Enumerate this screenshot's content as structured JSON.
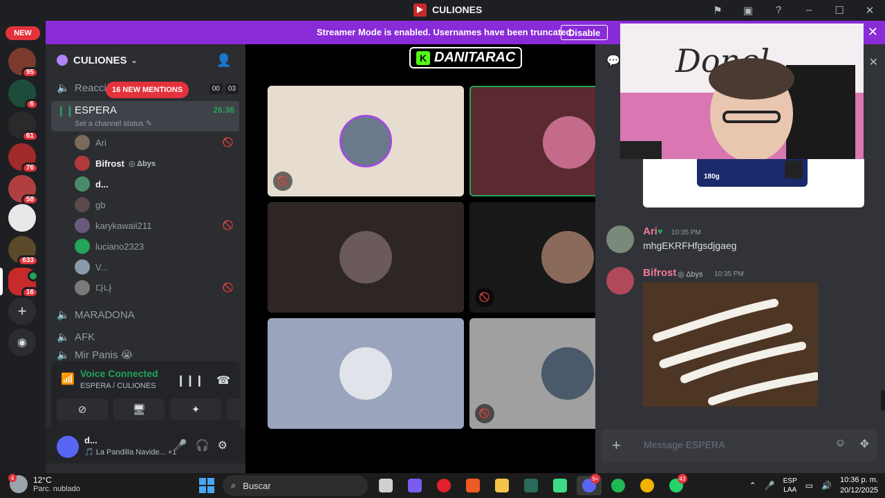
{
  "window": {
    "title": "CULIONES"
  },
  "rail": {
    "new_label": "NEW",
    "servers": [
      {
        "name": "server-1",
        "badge": "95",
        "color": "#7a3b2e"
      },
      {
        "name": "server-2",
        "badge": "6",
        "color": "#1d4d3a"
      },
      {
        "name": "server-3",
        "badge": "61",
        "color": "#2a2a2a"
      },
      {
        "name": "server-4",
        "badge": "76",
        "color": "#a12a2a"
      },
      {
        "name": "server-5",
        "badge": "58",
        "color": "#b04040"
      },
      {
        "name": "server-6",
        "badge": "",
        "color": "#e8e8e8"
      },
      {
        "name": "server-7",
        "badge": "633",
        "color": "#5a4a2a"
      },
      {
        "name": "server-8",
        "badge": "16",
        "color": "#c62a2a"
      }
    ]
  },
  "banner": {
    "text": "Streamer Mode is enabled. Usernames have been truncated.",
    "button": "Disable"
  },
  "sidebar": {
    "guild_name": "CULIONES",
    "channels_top": {
      "name": "Reacciones",
      "mentions": "16 NEW MENTIONS",
      "count_a": "00",
      "count_b": "03"
    },
    "active_channel": {
      "name": "ESPERA",
      "status": "Set a channel status",
      "timer": "26:36"
    },
    "users": [
      {
        "name": "Ari",
        "muted": true,
        "color": "#7a6a5a"
      },
      {
        "name": "Bifrost",
        "tag": "Δbys",
        "muted": false,
        "color": "#b03a3a",
        "bright": true
      },
      {
        "name": "d...",
        "muted": false,
        "color": "#4a8a6a",
        "bright": true
      },
      {
        "name": "gb",
        "muted": false,
        "color": "#5a4a4a"
      },
      {
        "name": "karykawaii211",
        "muted": true,
        "color": "#6a5a7a"
      },
      {
        "name": "luciano2323",
        "muted": false,
        "color": "#23a55a"
      },
      {
        "name": "V...",
        "muted": false,
        "color": "#8a9aaa"
      },
      {
        "name": "다나",
        "muted": true,
        "color": "#7a7a7a"
      }
    ],
    "other_channels": [
      "MARADONA",
      "AFK",
      "Mir Panis 😭"
    ]
  },
  "voice": {
    "title": "Voice Connected",
    "subtitle": "ESPERA / CULIONES"
  },
  "userbar": {
    "name": "d...",
    "status": "🎵 La Pandilla Navide...",
    "extra": "+1"
  },
  "stage": {
    "streamer_label": "DANITARAC",
    "kick_letter": "K"
  },
  "chat": {
    "messages": [
      {
        "author": "Ari",
        "time": "10:35 PM",
        "text": "mhgEKRFHfgsdjgaeg"
      },
      {
        "author": "Bifrost",
        "tag": "Δbys",
        "time": "10:35 PM",
        "text": ""
      }
    ],
    "placeholder": "Message ESPERA",
    "product_text": "180g"
  },
  "taskbar": {
    "temp": "12°C",
    "condition": "Parc. nublado",
    "weather_badge": "4",
    "search": "Buscar",
    "lang_a": "ESP",
    "lang_b": "LAA",
    "time": "10:36 p. m.",
    "date": "20/12/2025",
    "discord_badge": "9+",
    "whatsapp_badge": "43"
  },
  "colors": {
    "accent": "#5865f2",
    "streamer_banner": "#8a2bd8",
    "online": "#23a55a",
    "mention": "#e4323c"
  }
}
